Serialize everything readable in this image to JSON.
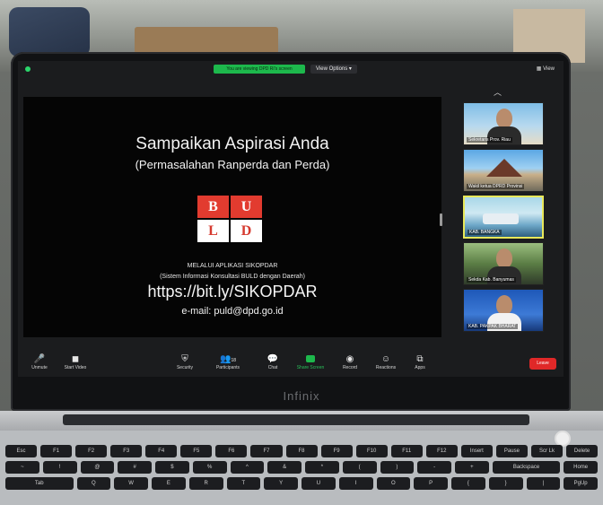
{
  "screen": {
    "top": {
      "recording_chip": "You are viewing DPD RI's screen",
      "view_options": "View Options",
      "view": "View"
    },
    "slide": {
      "title": "Sampaikan Aspirasi Anda",
      "subtitle": "(Permasalahan Ranperda dan Perda)",
      "logo": {
        "b": "B",
        "u": "U",
        "l": "L",
        "d": "D"
      },
      "via": "MELALUI APLIKASI SIKOPDAR",
      "system": "(Sistem Informasi Konsultasi BULD dengan Daerah)",
      "url": "https://bit.ly/SIKOPDAR",
      "email": "e-mail: puld@dpd.go.id"
    },
    "participants": [
      {
        "name": "Sekretaris Prov. Riau"
      },
      {
        "name": "Wakil ketua DPRD Provinsi"
      },
      {
        "name": "KAB. BANGKA"
      },
      {
        "name": "Sekda Kab. Banyumas"
      },
      {
        "name": "KAB. PAKPAK BHARAT"
      }
    ],
    "toolbar": {
      "unmute": "Unmute",
      "start_video": "Start Video",
      "security": "Security",
      "participants": "Participants",
      "participants_count": "18",
      "chat": "Chat",
      "share": "Share Screen",
      "record": "Record",
      "reactions": "Reactions",
      "apps": "Apps",
      "leave": "Leave"
    }
  },
  "laptop": {
    "brand": "Infinix"
  },
  "keyboard": {
    "row1": [
      "Esc",
      "F1",
      "F2",
      "F3",
      "F4",
      "F5",
      "F6",
      "F7",
      "F8",
      "F9",
      "F10",
      "F11",
      "F12",
      "Insert",
      "Pause",
      "Scr Lk",
      "Delete"
    ],
    "row2": [
      "~",
      "!",
      "@",
      "#",
      "$",
      "%",
      "^",
      "&",
      "*",
      "(",
      ")",
      "-",
      "+",
      "Backspace",
      "Home"
    ],
    "row3": [
      "Tab",
      "Q",
      "W",
      "E",
      "R",
      "T",
      "Y",
      "U",
      "I",
      "O",
      "P",
      "{",
      "}",
      "|",
      "PgUp"
    ]
  }
}
